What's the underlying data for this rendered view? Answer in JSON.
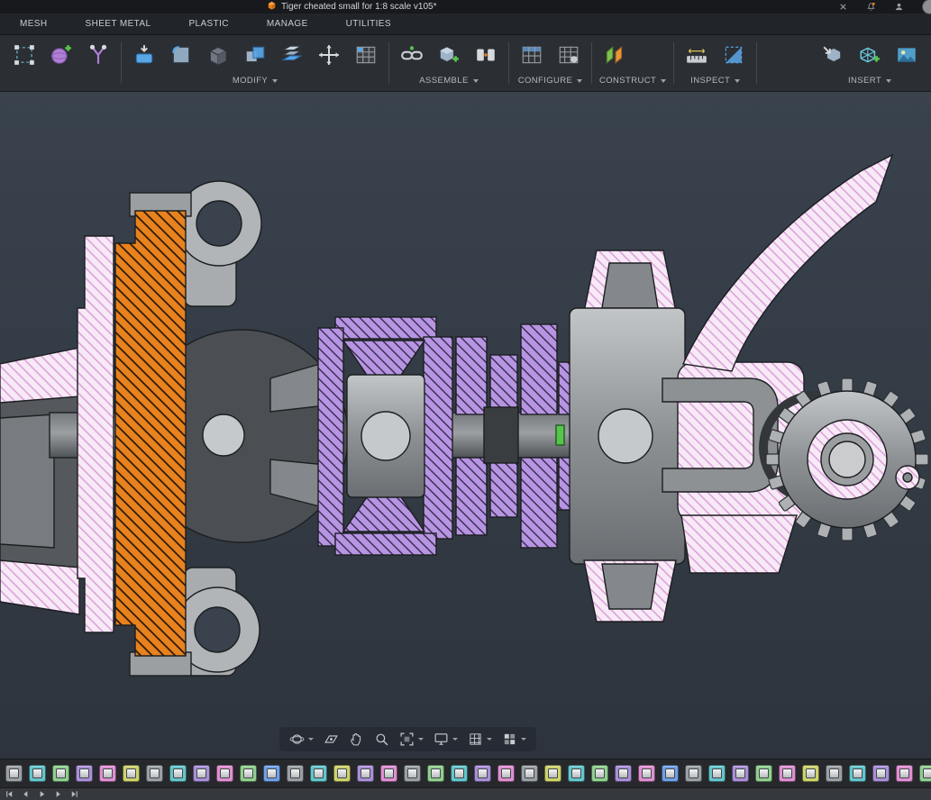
{
  "colors": {
    "accent_blue": "#3d9bd1",
    "hatch_orange": "#e8821e",
    "hatch_pink_bg": "#f8e9f6",
    "hatch_pink_line": "#d79ad7",
    "hatch_purple_bg": "#b795e3",
    "hatch_purple_line": "#2a2140",
    "viewport_top": "#39424d",
    "viewport_bottom": "#2d343d",
    "metal_light": "#b2b5b8",
    "metal_mid": "#8d9194",
    "metal_dark": "#4b4f54",
    "green_marker": "#57c44d",
    "titlebar_bg": "#17191c",
    "tabs_bg": "#212429",
    "toolbar_bg": "#2b2e33",
    "timeline_bg": "#26282c",
    "controls_bg": "#35383c"
  },
  "titlebar": {
    "title": "Tiger cheated small for 1:8 scale v105*"
  },
  "ribbon_tabs": [
    "MESH",
    "SHEET METAL",
    "PLASTIC",
    "MANAGE",
    "UTILITIES"
  ],
  "toolbar": {
    "groups": [
      {
        "name": "select",
        "label": "",
        "icons": [
          "marquee-select",
          "create-form",
          "trim"
        ]
      },
      {
        "name": "modify",
        "label": "MODIFY",
        "icons": [
          "press-pull",
          "fillet",
          "shell",
          "combine",
          "offset-face",
          "move-copy",
          "pattern"
        ]
      },
      {
        "name": "assemble",
        "label": "ASSEMBLE",
        "icons": [
          "joint-link",
          "new-component",
          "joint"
        ]
      },
      {
        "name": "configure",
        "label": "CONFIGURE",
        "icons": [
          "config-table",
          "config-table2"
        ]
      },
      {
        "name": "construct",
        "label": "CONSTRUCT",
        "icons": [
          "construct-planes"
        ]
      },
      {
        "name": "inspect",
        "label": "INSPECT",
        "icons": [
          "measure",
          "section-analysis"
        ]
      },
      {
        "name": "insert",
        "label": "INSERT",
        "icons": [
          "insert-derive",
          "insert-mesh",
          "canvas-image"
        ]
      }
    ]
  },
  "view_toolbar": [
    {
      "name": "orbit",
      "caret": true
    },
    {
      "name": "look-at",
      "caret": false
    },
    {
      "name": "pan",
      "caret": false
    },
    {
      "name": "zoom",
      "caret": false
    },
    {
      "name": "fit",
      "caret": true
    },
    {
      "name": "display-settings",
      "caret": true
    },
    {
      "name": "grid-settings",
      "caret": true
    },
    {
      "name": "viewports",
      "caret": true
    }
  ],
  "timeline": {
    "features": [
      "#9aa0a6",
      "#62c6cc",
      "#8fd08f",
      "#a98fd8",
      "#e08fd2",
      "#cdd36a",
      "#9aa0a6",
      "#62c6cc",
      "#a98fd8",
      "#e08fd2",
      "#8fd08f",
      "#6f9fe8",
      "#9aa0a6",
      "#62c6cc",
      "#cdd36a",
      "#a98fd8",
      "#e08fd2",
      "#9aa0a6",
      "#8fd08f",
      "#62c6cc",
      "#a98fd8",
      "#e08fd2",
      "#9aa0a6",
      "#cdd36a",
      "#62c6cc",
      "#8fd08f",
      "#a98fd8",
      "#e08fd2",
      "#6f9fe8",
      "#9aa0a6",
      "#62c6cc",
      "#a98fd8",
      "#8fd08f",
      "#e08fd2",
      "#cdd36a",
      "#9aa0a6",
      "#62c6cc",
      "#a98fd8",
      "#e08fd2",
      "#8fd08f",
      "#6f9fe8",
      "#9aa0a6"
    ],
    "playback": [
      "go-to-start",
      "step-back",
      "play",
      "step-forward",
      "go-to-end"
    ]
  }
}
